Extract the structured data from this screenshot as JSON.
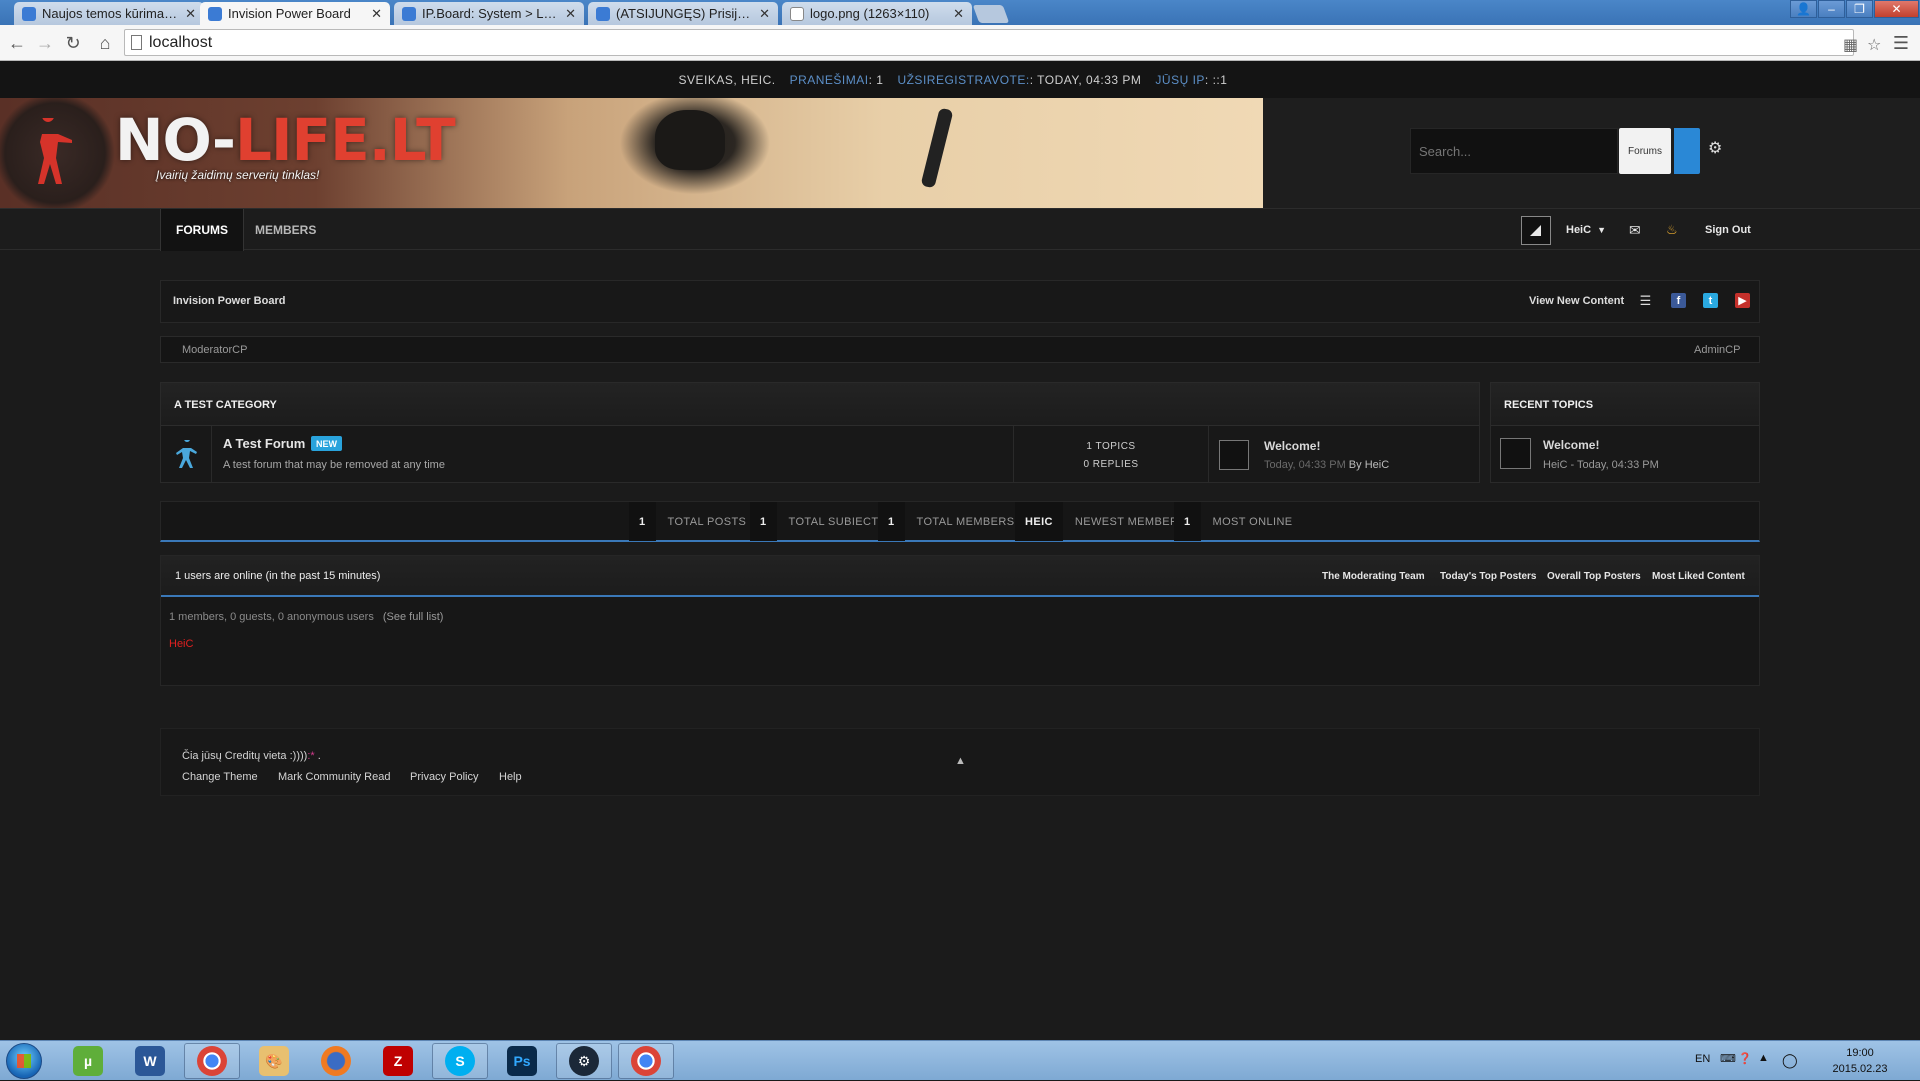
{
  "browser": {
    "tabs": [
      {
        "label": "Naujos temos kūrimas - S",
        "active": false
      },
      {
        "label": "Invision Power Board",
        "active": true
      },
      {
        "label": "IP.Board: System > Look &",
        "active": false
      },
      {
        "label": "(ATSIJUNGĘS) Prisijungim",
        "active": false
      },
      {
        "label": "logo.png (1263×110)",
        "active": false
      }
    ],
    "tab_close": "✕",
    "url": "localhost",
    "window_buttons": {
      "user": "👤",
      "minimize": "–",
      "restore": "❐",
      "close": "✕"
    }
  },
  "userbar": {
    "greeting": "SVEIKAS, HEIC.",
    "messages_key": "PRANEŠIMAI",
    "messages_value": ": 1",
    "registered_key": "UŽSIREGISTRAVOTE:",
    "registered_value": ": TODAY, 04:33 PM",
    "ip_key": "JŪSŲ IP",
    "ip_value": ": ::1"
  },
  "banner": {
    "logo_main": "NO-",
    "logo_accent": "LIFE.LT",
    "tagline": "Įvairių žaidimų serverių tinklas!"
  },
  "search": {
    "placeholder": "Search...",
    "scope": "Forums"
  },
  "nav": {
    "tabs": [
      "FORUMS",
      "MEMBERS"
    ],
    "user_name": "HeiC",
    "sign_out": "Sign Out"
  },
  "breadcrumb": {
    "root": "Invision Power Board",
    "view_new_content": "View New Content",
    "social": [
      "list-icon",
      "facebook-icon",
      "twitter-icon",
      "youtube-icon"
    ]
  },
  "modbar": {
    "left": "ModeratorCP",
    "right": "AdminCP"
  },
  "category": {
    "title": "A TEST CATEGORY",
    "forum": {
      "name": "A Test Forum",
      "badge": "NEW",
      "description": "A test forum that may be removed at any time",
      "topics": "1 TOPICS",
      "replies": "0 REPLIES",
      "last_post_title": "Welcome!",
      "last_post_time": "Today, 04:33 PM",
      "last_post_by": "By",
      "last_post_author": "HeiC"
    }
  },
  "recent": {
    "title": "RECENT TOPICS",
    "topic_title": "Welcome!",
    "topic_meta": "HeiC - Today, 04:33 PM"
  },
  "stats": [
    {
      "num": "1",
      "label": "TOTAL POSTS"
    },
    {
      "num": "1",
      "label": "TOTAL SUBIECTE"
    },
    {
      "num": "1",
      "label": "TOTAL MEMBERS"
    },
    {
      "num": "HEIC",
      "label": "NEWEST MEMBER"
    },
    {
      "num": "1",
      "label": "MOST ONLINE"
    }
  ],
  "online": {
    "title": "1 users are online (in the past 15 minutes)",
    "links": [
      "The Moderating Team",
      "Today's Top Posters",
      "Overall Top Posters",
      "Most Liked Content"
    ],
    "summary": "1 members, 0 guests, 0 anonymous users",
    "full_list": "(See full list)",
    "user": "HeiC"
  },
  "footer": {
    "credit_text": "Čia jūsų Creditų vieta :))))",
    "credit_smile": ":*",
    "credit_end": " .",
    "links": [
      "Change Theme",
      "Mark Community Read",
      "Privacy Policy",
      "Help"
    ],
    "to_top": "▲"
  },
  "taskbar": {
    "apps": [
      "utorrent-icon",
      "word-icon",
      "chrome-icon",
      "paint-icon",
      "firefox-icon",
      "filezilla-icon",
      "skype-icon",
      "photoshop-icon",
      "steam-icon",
      "chrome-icon"
    ],
    "lang": "EN",
    "time": "19:00",
    "date": "2015.02.23"
  },
  "colors": {
    "accent": "#3a78b8",
    "badge": "#29a3dc",
    "online_user": "#e02020",
    "userbar_key": "#5c8fc7"
  }
}
